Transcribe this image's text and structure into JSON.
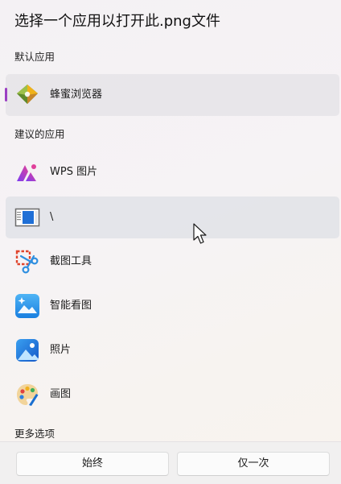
{
  "dialog": {
    "title": "选择一个应用以打开此.png文件"
  },
  "sections": {
    "default": "默认应用",
    "suggested": "建议的应用",
    "more": "更多选项"
  },
  "default_app": {
    "label": "蜂蜜浏览器",
    "icon": "honey-browser-icon"
  },
  "suggested_apps": [
    {
      "label": "WPS 图片",
      "icon": "wps-pictures-icon"
    },
    {
      "label": "\\",
      "icon": "unnamed-app-window-icon"
    },
    {
      "label": "截图工具",
      "icon": "snipping-tool-icon"
    },
    {
      "label": "智能看图",
      "icon": "smart-viewer-icon"
    },
    {
      "label": "照片",
      "icon": "photos-icon"
    },
    {
      "label": "画图",
      "icon": "paint-icon"
    }
  ],
  "buttons": {
    "always": "始终",
    "just_once": "仅一次"
  },
  "colors": {
    "accent": "#9b3fc3",
    "selected_row": "#e4e2e7",
    "hover_row": "#e1e3e9"
  }
}
